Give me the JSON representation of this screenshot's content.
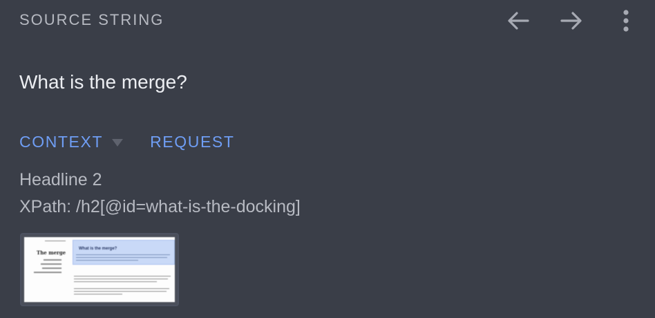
{
  "header": {
    "title": "SOURCE STRING",
    "back_icon": "arrow-left-icon",
    "forward_icon": "arrow-right-icon",
    "menu_icon": "more-vertical-icon"
  },
  "source": {
    "text": "What is the merge?"
  },
  "tabs": [
    {
      "label": "CONTEXT",
      "has_dropdown": true
    },
    {
      "label": "REQUEST"
    }
  ],
  "context": {
    "element_type": "Headline 2",
    "xpath": "XPath: /h2[@id=what-is-the-docking]"
  },
  "screenshot_thumbnail": {
    "page_title": "The merge",
    "highlight_heading": "What is the merge?"
  },
  "colors": {
    "background": "#3a3e48",
    "accent": "#6f9ef5",
    "text_primary": "#eceef2",
    "text_secondary": "#b7bac2",
    "icon": "#a7aab3"
  }
}
